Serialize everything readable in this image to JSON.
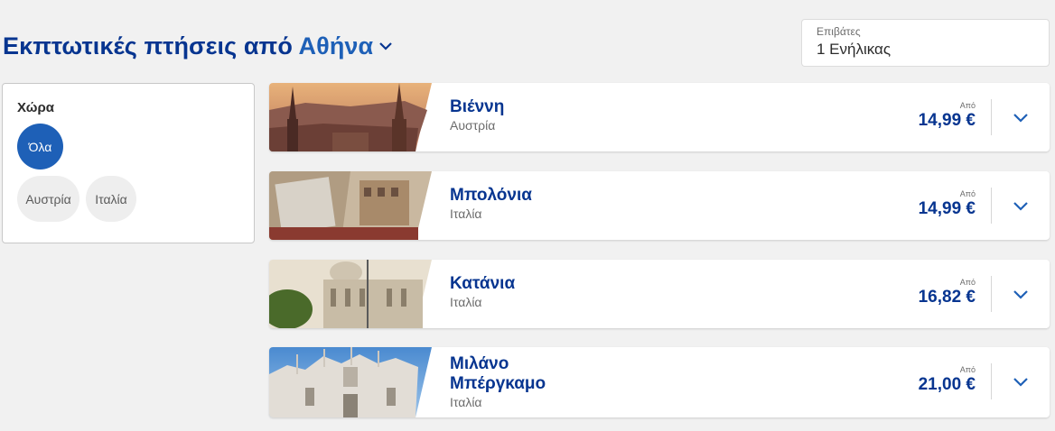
{
  "header": {
    "title_prefix": "Εκπτωτικές πτήσεις από",
    "origin_city": "Αθήνα"
  },
  "passengers": {
    "label": "Επιβάτες",
    "value": "1 Ενήλικας"
  },
  "filter": {
    "title": "Χώρα",
    "all_label": "Όλα",
    "options": [
      "Αυστρία",
      "Ιταλία"
    ]
  },
  "destinations": [
    {
      "name": "Βιέννη",
      "country": "Αυστρία",
      "from_label": "Από",
      "price": "14,99 €"
    },
    {
      "name": "Μπολόνια",
      "country": "Ιταλία",
      "from_label": "Από",
      "price": "14,99 €"
    },
    {
      "name": "Κατάνια",
      "country": "Ιταλία",
      "from_label": "Από",
      "price": "16,82 €"
    },
    {
      "name_line1": "Μιλάνο",
      "name_line2": "Μπέργκαμο",
      "country": "Ιταλία",
      "from_label": "Από",
      "price": "21,00 €"
    }
  ],
  "colors": {
    "navy": "#073590",
    "accent_blue": "#1e60b7",
    "page_bg": "#f1f1f1"
  },
  "icons": {
    "city_dropdown": "chevron-down-icon",
    "card_expand": "chevron-down-icon"
  }
}
